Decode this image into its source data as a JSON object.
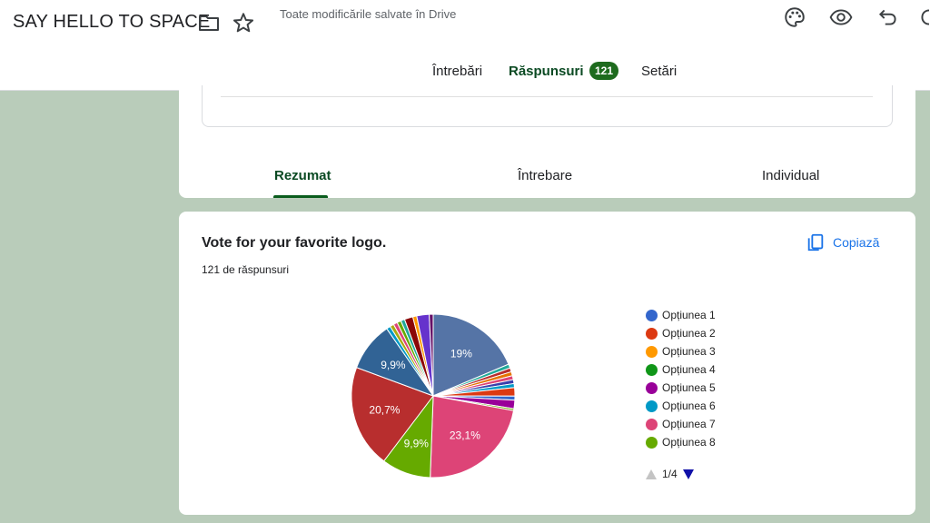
{
  "header": {
    "title": "SAY HELLO TO SPACE",
    "saved_status": "Toate modificările salvate în Drive",
    "icons": [
      "folder-icon",
      "star-icon",
      "palette-icon",
      "eye-icon",
      "undo-icon",
      "more-icon"
    ]
  },
  "main_tabs": {
    "questions": "Întrebări",
    "responses": "Răspunsuri",
    "response_count": "121",
    "settings": "Setări"
  },
  "sub_tabs": {
    "summary": "Rezumat",
    "question": "Întrebare",
    "individual": "Individual"
  },
  "question": {
    "title": "Vote for your favorite logo.",
    "response_count": "121 de răspunsuri",
    "copy_label": "Copiază"
  },
  "legend": {
    "items": [
      {
        "label": "Opțiunea 1",
        "color": "#3366cc"
      },
      {
        "label": "Opțiunea 2",
        "color": "#dc3912"
      },
      {
        "label": "Opțiunea 3",
        "color": "#ff9900"
      },
      {
        "label": "Opțiunea 4",
        "color": "#109618"
      },
      {
        "label": "Opțiunea 5",
        "color": "#990099"
      },
      {
        "label": "Opțiunea 6",
        "color": "#0099c6"
      },
      {
        "label": "Opțiunea 7",
        "color": "#dd4477"
      },
      {
        "label": "Opțiunea 8",
        "color": "#66aa00"
      }
    ],
    "page": "1/4"
  },
  "chart_data": {
    "type": "pie",
    "slices": [
      {
        "value": 19.0,
        "color": "#5574a6",
        "label": "19%"
      },
      {
        "value": 0.8,
        "color": "#22aa99"
      },
      {
        "value": 0.8,
        "color": "#b82e2e"
      },
      {
        "value": 0.8,
        "color": "#e67300"
      },
      {
        "value": 0.8,
        "color": "#dd4477"
      },
      {
        "value": 0.8,
        "color": "#3b3eac"
      },
      {
        "value": 0.8,
        "color": "#0099c6"
      },
      {
        "value": 1.7,
        "color": "#dc3912"
      },
      {
        "value": 0.8,
        "color": "#3366cc"
      },
      {
        "value": 1.7,
        "color": "#990099"
      },
      {
        "value": 0.4,
        "color": "#66aa00"
      },
      {
        "value": 23.1,
        "color": "#dd4477",
        "label": "23,1%"
      },
      {
        "value": 9.9,
        "color": "#66aa00",
        "label": "9,9%"
      },
      {
        "value": 20.7,
        "color": "#b82e2e",
        "label": "20,7%"
      },
      {
        "value": 9.9,
        "color": "#316395",
        "label": "9,9%"
      },
      {
        "value": 0.8,
        "color": "#0099c6"
      },
      {
        "value": 0.8,
        "color": "#aaaa11"
      },
      {
        "value": 0.8,
        "color": "#dd4477"
      },
      {
        "value": 0.8,
        "color": "#66aa00"
      },
      {
        "value": 0.8,
        "color": "#22aa99"
      },
      {
        "value": 1.7,
        "color": "#8b0707"
      },
      {
        "value": 0.8,
        "color": "#ff9900"
      },
      {
        "value": 2.5,
        "color": "#6633cc"
      },
      {
        "value": 0.8,
        "color": "#651067"
      }
    ]
  }
}
